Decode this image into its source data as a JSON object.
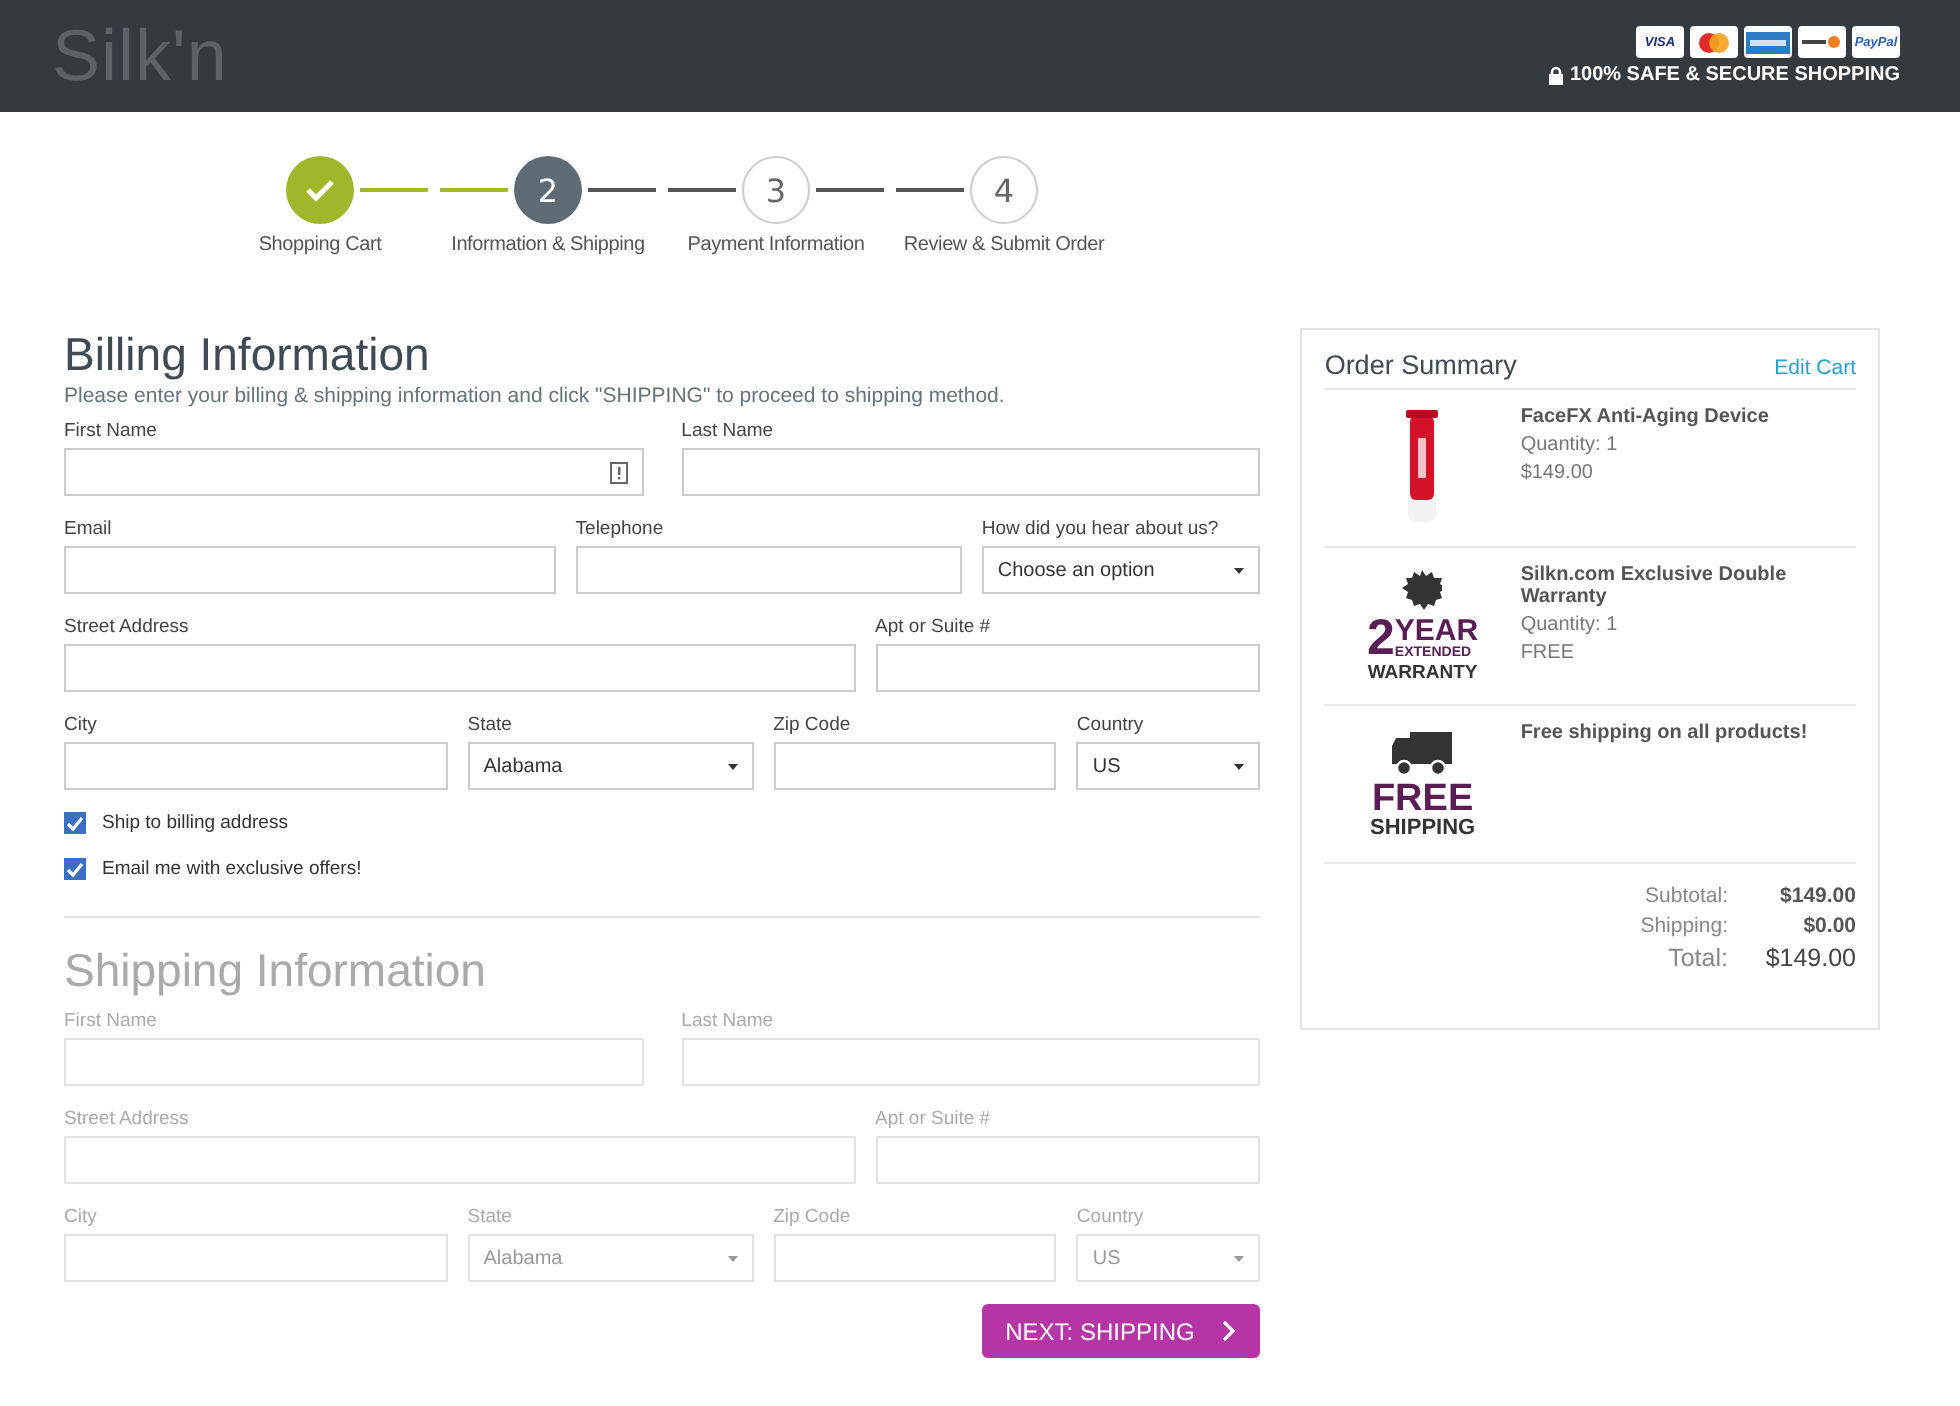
{
  "header": {
    "logo": "Silk'n",
    "payment_cards": [
      {
        "kind": "visa",
        "label": "VISA"
      },
      {
        "kind": "mastercard"
      },
      {
        "kind": "amex"
      },
      {
        "kind": "discover"
      },
      {
        "kind": "paypal",
        "label": "PayPal"
      }
    ],
    "secure_text": "100% SAFE & SECURE SHOPPING"
  },
  "steps": [
    {
      "label": "Shopping Cart",
      "done": true,
      "current": false
    },
    {
      "number": "2",
      "label": "Information & Shipping",
      "done": false,
      "current": true
    },
    {
      "number": "3",
      "label": "Payment Information",
      "done": false,
      "current": false
    },
    {
      "number": "4",
      "label": "Review & Submit Order",
      "done": false,
      "current": false
    }
  ],
  "billing": {
    "title": "Billing Information",
    "intro": "Please enter your billing & shipping information and click \"SHIPPING\" to proceed to shipping method.",
    "disabled": false,
    "lines": [
      {
        "fields": [
          {
            "label": "First Name",
            "kind": "text",
            "autofill_icon": true
          },
          {
            "label": "Last Name",
            "kind": "text"
          }
        ]
      },
      {
        "fields": [
          {
            "label": "Email",
            "kind": "text"
          },
          {
            "label": "Telephone",
            "kind": "text"
          },
          {
            "label": "How did you hear about us?",
            "kind": "select",
            "value": "Choose an option"
          }
        ]
      },
      {
        "fields": [
          {
            "label": "Street Address",
            "kind": "text"
          },
          {
            "label": "Apt or Suite #",
            "kind": "text"
          }
        ]
      },
      {
        "fields": [
          {
            "label": "City",
            "kind": "text"
          },
          {
            "label": "State",
            "kind": "select",
            "value": "Alabama"
          },
          {
            "label": "Zip Code",
            "kind": "text"
          },
          {
            "label": "Country",
            "kind": "select",
            "value": "US"
          }
        ]
      }
    ],
    "checkboxes": [
      {
        "label": "Ship to billing address",
        "checked": true
      },
      {
        "label": "Email me with exclusive offers!",
        "checked": true
      }
    ]
  },
  "shipping": {
    "title": "Shipping Information",
    "disabled": true,
    "lines": [
      {
        "fields": [
          {
            "label": "First Name",
            "kind": "text"
          },
          {
            "label": "Last Name",
            "kind": "text"
          }
        ]
      },
      {
        "fields": [
          {
            "label": "Street Address",
            "kind": "text"
          },
          {
            "label": "Apt or Suite #",
            "kind": "text"
          }
        ]
      },
      {
        "fields": [
          {
            "label": "City",
            "kind": "text"
          },
          {
            "label": "State",
            "kind": "select",
            "value": "Alabama"
          },
          {
            "label": "Zip Code",
            "kind": "text"
          },
          {
            "label": "Country",
            "kind": "select",
            "value": "US"
          }
        ]
      }
    ]
  },
  "next_button": "NEXT: SHIPPING",
  "order_summary": {
    "title": "Order Summary",
    "edit_link": "Edit Cart",
    "items": [
      {
        "kind": "product",
        "name": "FaceFX Anti-Aging Device",
        "quantity": "Quantity: 1",
        "price": "$149.00"
      },
      {
        "kind": "warranty",
        "badge": [
          "2",
          "YEAR",
          "EXTENDED",
          "WARRANTY"
        ],
        "name": "Silkn.com Exclusive Double Warranty",
        "quantity": "Quantity: 1",
        "price": "FREE"
      },
      {
        "kind": "shipping",
        "badge": [
          "FREE",
          "SHIPPING"
        ],
        "name": "Free shipping on all products!"
      }
    ],
    "totals": [
      {
        "label": "Subtotal:",
        "value": "$149.00",
        "grand": false
      },
      {
        "label": "Shipping:",
        "value": "$0.00",
        "grand": false
      },
      {
        "label": "Total:",
        "value": "$149.00",
        "grand": true
      }
    ]
  }
}
